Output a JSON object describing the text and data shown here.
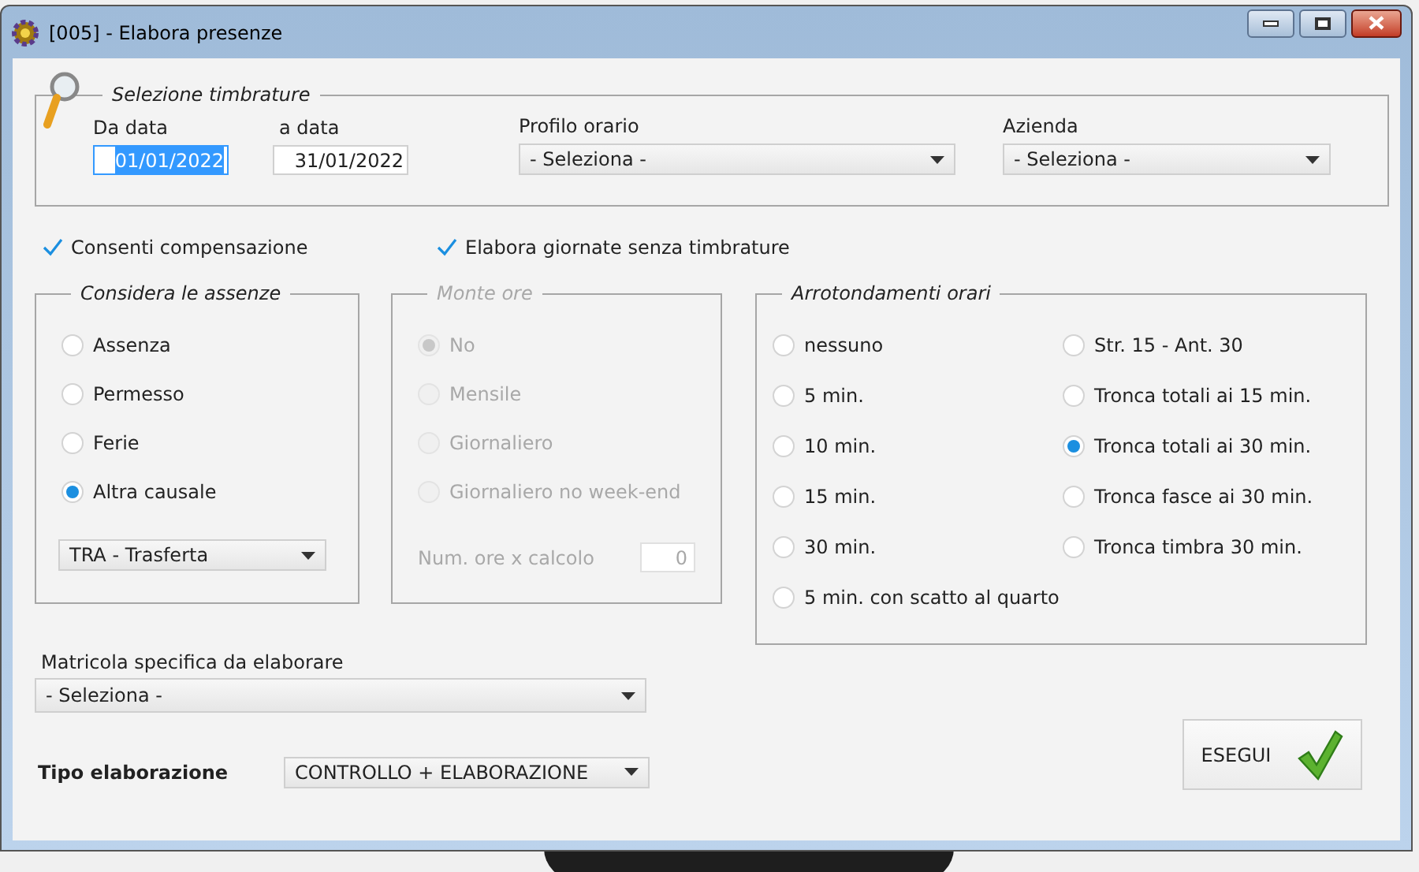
{
  "window": {
    "title": "[005] - Elabora presenze"
  },
  "selection": {
    "legend": "Selezione timbrature",
    "from_label": "Da data",
    "from_value": "01/01/2022",
    "from_focused": true,
    "to_label": "a data",
    "to_value": "31/01/2022",
    "profile_label": "Profilo orario",
    "profile_value": "- Seleziona -",
    "company_label": "Azienda",
    "company_value": "- Seleziona -"
  },
  "checkboxes": [
    {
      "label": "Consenti compensazione",
      "checked": true
    },
    {
      "label": "Elabora giornate senza timbrature",
      "checked": true
    }
  ],
  "absences": {
    "legend": "Considera le assenze",
    "disabled": false,
    "options": [
      {
        "label": "Assenza",
        "selected": false
      },
      {
        "label": "Permesso",
        "selected": false
      },
      {
        "label": "Ferie",
        "selected": false
      },
      {
        "label": "Altra causale",
        "selected": true
      }
    ],
    "causale": "TRA - Trasferta"
  },
  "hours_bank": {
    "legend": "Monte ore",
    "disabled": true,
    "options": [
      {
        "label": "No",
        "selected": true
      },
      {
        "label": "Mensile",
        "selected": false
      },
      {
        "label": "Giornaliero",
        "selected": false
      },
      {
        "label": "Giornaliero no week-end",
        "selected": false
      }
    ],
    "calc_label": "Num. ore x calcolo",
    "calc_value": "0"
  },
  "rounding": {
    "legend": "Arrotondamenti orari",
    "left_options": [
      {
        "label": "nessuno",
        "selected": false
      },
      {
        "label": "5 min.",
        "selected": false
      },
      {
        "label": "10 min.",
        "selected": false
      },
      {
        "label": "15 min.",
        "selected": false
      },
      {
        "label": "30 min.",
        "selected": false
      },
      {
        "label": "5 min. con scatto al quarto",
        "selected": false
      }
    ],
    "right_options": [
      {
        "label": "Str. 15 - Ant. 30",
        "selected": false
      },
      {
        "label": "Tronca totali ai 15 min.",
        "selected": false
      },
      {
        "label": "Tronca totali ai 30 min.",
        "selected": true
      },
      {
        "label": "Tronca fasce ai 30 min.",
        "selected": false
      },
      {
        "label": "Tronca timbra 30 min.",
        "selected": false
      }
    ]
  },
  "employee": {
    "label": "Matricola specifica da elaborare",
    "value": "- Seleziona -"
  },
  "processing_type": {
    "label": "Tipo elaborazione",
    "value": "CONTROLLO + ELABORAZIONE"
  },
  "run_button": {
    "label": "ESEGUI"
  }
}
